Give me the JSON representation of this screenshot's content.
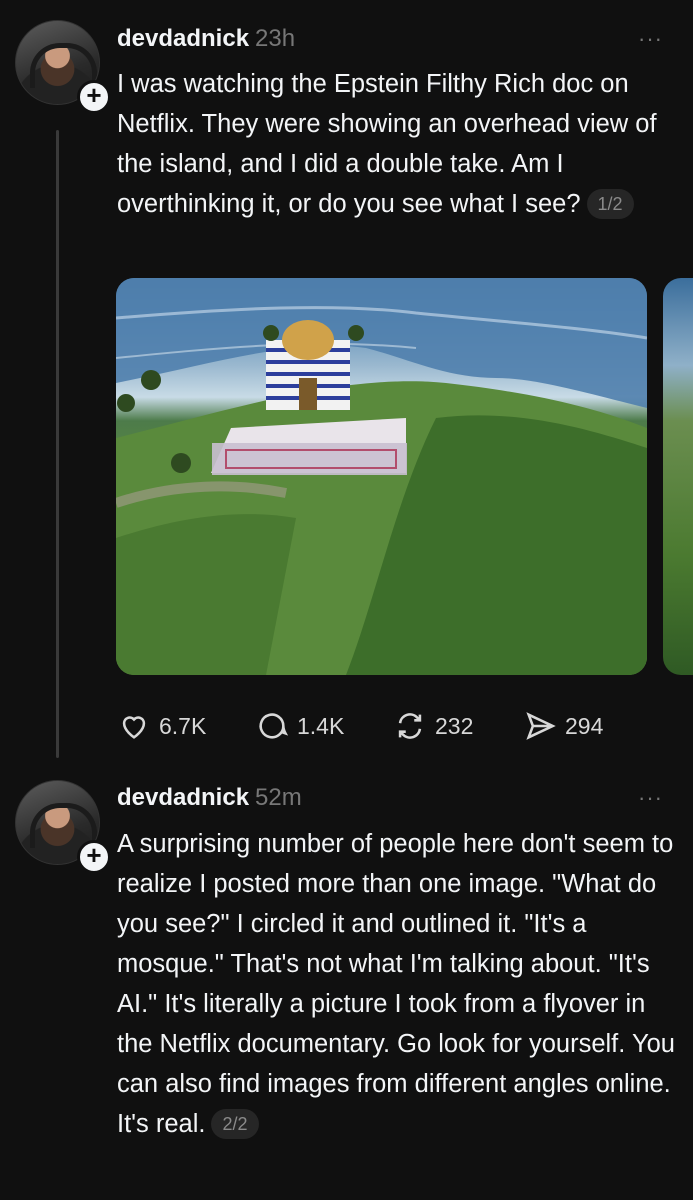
{
  "posts": [
    {
      "username": "devdadnick",
      "time": "23h",
      "text": "I was watching the Epstein Filthy Rich doc on Netflix. They were showing an overhead view of the island, and I did a double take. Am I overthinking it, or do you see what I see?",
      "pager": "1/2",
      "more": "···",
      "follow_glyph": "+",
      "actions": {
        "likes": "6.7K",
        "replies": "1.4K",
        "reposts": "232",
        "shares": "294"
      }
    },
    {
      "username": "devdadnick",
      "time": "52m",
      "text": "A surprising number of people here don't seem to realize I posted more than one image. \"What do you see?\" I circled it and outlined it. \"It's a mosque.\" That's not what I'm talking about. \"It's AI.\" It's literally a picture I took from a flyover in the Netflix documentary. Go look for yourself. You can also find images from different angles online. It's real.",
      "pager": "2/2",
      "more": "···",
      "follow_glyph": "+"
    }
  ],
  "icons": {
    "like": "heart-icon",
    "reply": "comment-icon",
    "repost": "repost-icon",
    "share": "send-icon"
  },
  "colors": {
    "background": "#101010",
    "text": "#f3f5f7",
    "muted": "#777777",
    "thread_line": "#3a3a3a"
  }
}
